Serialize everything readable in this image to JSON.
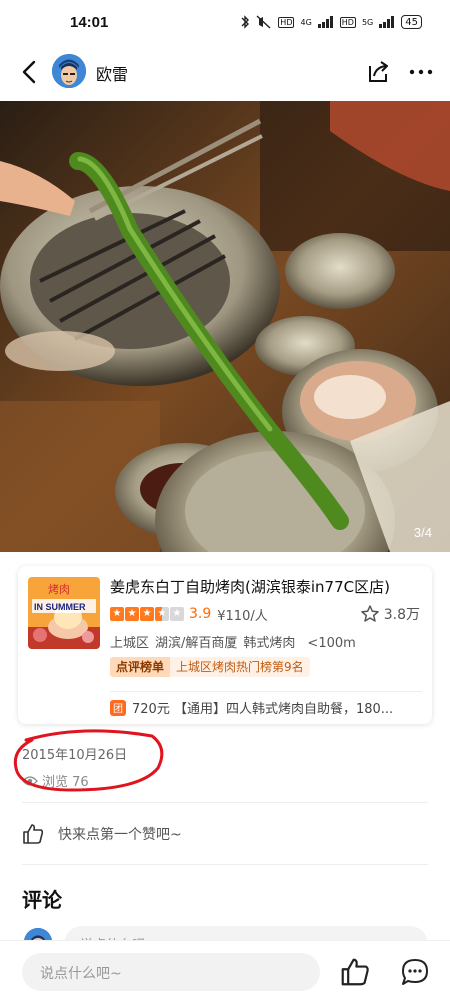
{
  "status_bar": {
    "time": "14:01",
    "signal_labels": [
      "HD",
      "4G",
      "HD",
      "5G"
    ],
    "battery": "45"
  },
  "nav": {
    "author_name": "欧雷",
    "icons": [
      "back-arrow-icon",
      "avatar",
      "share-icon",
      "more-icon"
    ]
  },
  "photo": {
    "counter": "3/4"
  },
  "shop": {
    "name": "姜虎东白丁自助烤肉(湖滨银泰in77C区店)",
    "thumb_text_top": "烤肉",
    "thumb_text_bottom": "IN SUMMER",
    "stars": 3.5,
    "score": "3.9",
    "price": "¥110/人",
    "favorites": "3.8万",
    "district": "上城区",
    "area": "湖滨/解百商厦",
    "category": "韩式烤肉",
    "distance": "<100m",
    "badge_main": "点评榜单",
    "badge_sub": "上城区烤肉热门榜第9名",
    "deal_icon": "团",
    "deal_text": "720元 【通用】四人韩式烤肉自助餐，180..."
  },
  "post": {
    "date": "2015年10月26日",
    "views": "浏览 76",
    "like_prompt": "快来点第一个赞吧~",
    "comments_title": "评论",
    "comment_placeholder": "说点什么吧~"
  },
  "bottom_bar": {
    "input_placeholder": "说点什么吧~"
  },
  "colors": {
    "accent_orange": "#ff6a00",
    "annotation_red": "#e0141e"
  }
}
